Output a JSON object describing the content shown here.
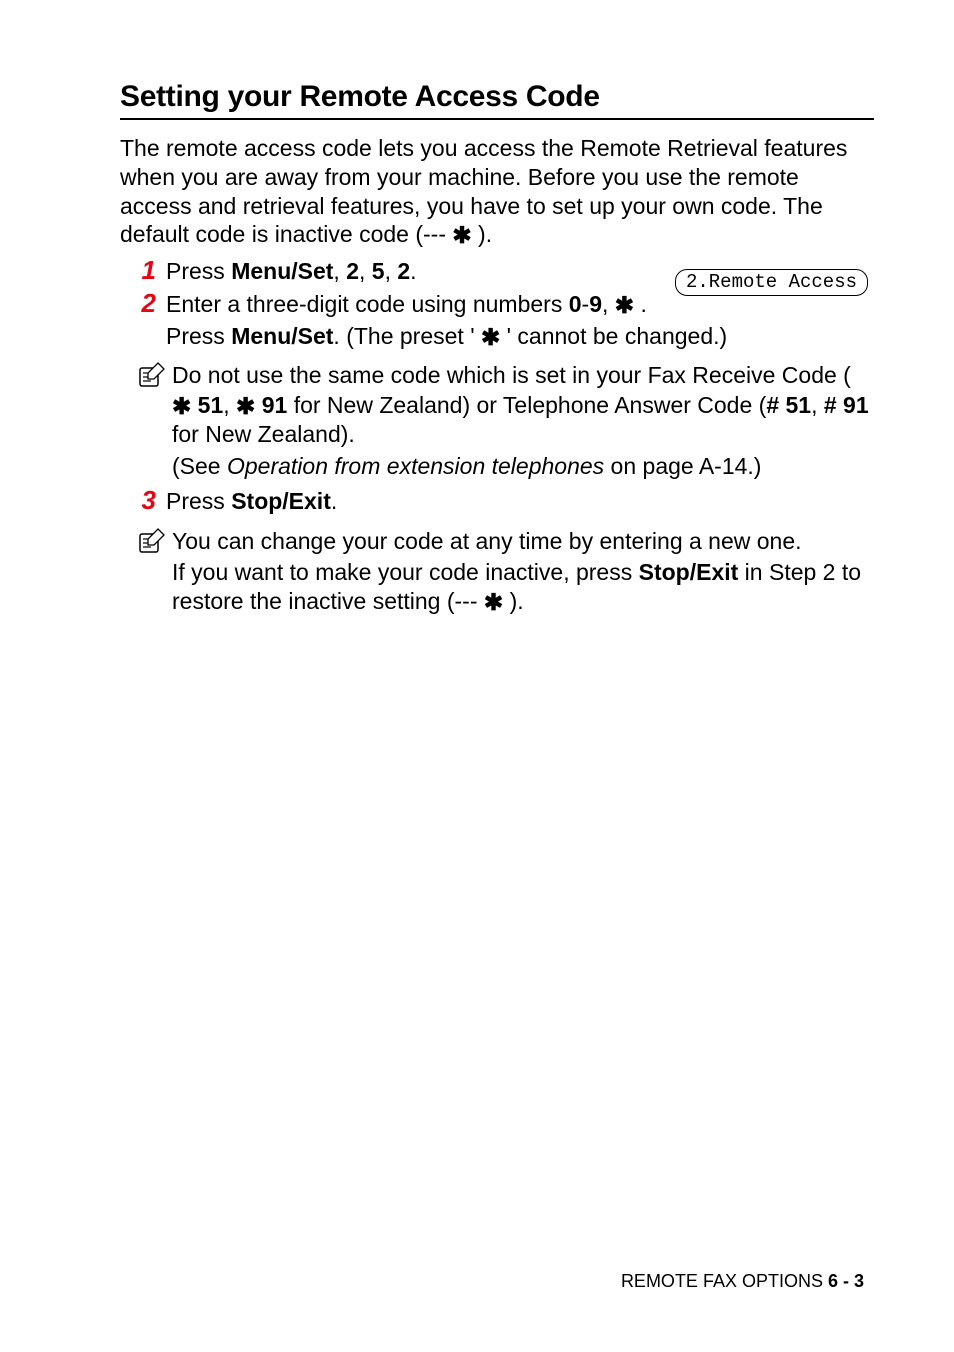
{
  "title": "Setting your Remote Access Code",
  "intro": {
    "line1": "The remote access code lets you access the Remote Retrieval features when you are away from your machine. Before you use the remote access and retrieval features, you have to set up your own code. The default code is inactive code (--- ",
    "line1_end": " )."
  },
  "lcd": "2.Remote Access",
  "steps": {
    "s1": {
      "num": "1",
      "pre": "Press ",
      "menu": "Menu/Set",
      "seq1": ", ",
      "k1": "2",
      "seq2": ", ",
      "k2": "5",
      "seq3": ", ",
      "k3": "2",
      "end": "."
    },
    "s2": {
      "num": "2",
      "line1a": "Enter a three-digit code using numbers ",
      "d0": "0",
      "dash": "-",
      "d9": "9",
      "comma": ", ",
      "period": " .",
      "line2a": "Press ",
      "menu": "Menu/Set",
      "line2b": ". (The preset ' ",
      "line2c": " ' cannot be changed.)"
    },
    "s3": {
      "num": "3",
      "pre": "Press ",
      "btn": "Stop/Exit",
      "end": "."
    }
  },
  "note1": {
    "line1a": "Do not use the same code which is set in your Fax Receive Code ( ",
    "code1": "51",
    "sep1": ",  ",
    "code2": "91",
    "line1b": " for New Zealand) or Telephone Answer Code (",
    "code3": "# 51",
    "sep2": ", ",
    "code4": "# 91",
    "line1c": " for New Zealand).",
    "line2a": "(See ",
    "ref": "Operation from extension telephones",
    "line2b": " on page A-14.)"
  },
  "note2": {
    "line1": "You can change your code at any time by entering a new one.",
    "line2a": "If you want to make your code inactive, press ",
    "btn": "Stop/Exit",
    "line2b": " in Step 2 to restore the inactive setting (--- ",
    "line2c": " )."
  },
  "footer": {
    "section": "REMOTE FAX OPTIONS   ",
    "page": "6 - 3"
  }
}
